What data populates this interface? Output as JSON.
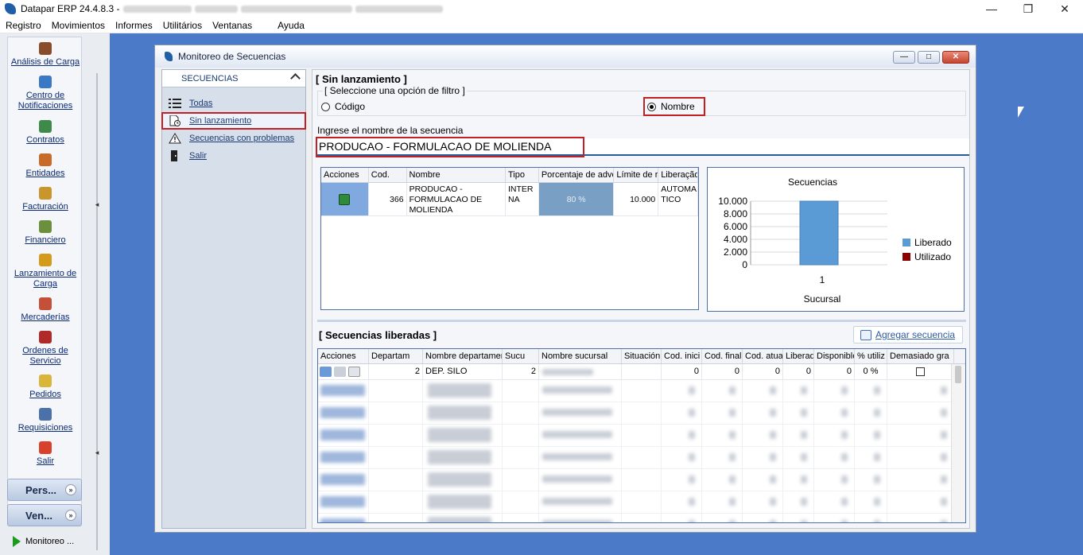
{
  "app": {
    "title": "Datapar ERP 24.4.8.3 -",
    "window_buttons": [
      "—",
      "❐",
      "✕"
    ]
  },
  "menu": [
    "Registro",
    "Movimientos",
    "Informes",
    "Utilitários",
    "Ventanas",
    "Ayuda"
  ],
  "sidebar": {
    "items": [
      {
        "label": "Análisis de Carga",
        "icon": "weight-icon",
        "color": "#8a4b2a"
      },
      {
        "label": "Centro de Notificaciones",
        "icon": "monitor-bell-icon",
        "color": "#3b79c4"
      },
      {
        "label": "Contratos",
        "icon": "contract-icon",
        "color": "#3d8a4a"
      },
      {
        "label": "Entidades",
        "icon": "people-icon",
        "color": "#c86b28"
      },
      {
        "label": "Facturación",
        "icon": "money-bag-icon",
        "color": "#c9962b"
      },
      {
        "label": "Financiero",
        "icon": "coin-bag-icon",
        "color": "#6b8f3a"
      },
      {
        "label": "Lanzamiento de Carga",
        "icon": "truck-icon",
        "color": "#d49a1a"
      },
      {
        "label": "Mercaderías",
        "icon": "box-icon",
        "color": "#c4503a"
      },
      {
        "label": "Ordenes de Servicio",
        "icon": "service-order-icon",
        "color": "#b02a2a"
      },
      {
        "label": "Pedidos",
        "icon": "pedidos-icon",
        "color": "#d9b63a"
      },
      {
        "label": "Requisiciones",
        "icon": "pencil-check-icon",
        "color": "#4a72a8"
      },
      {
        "label": "Salir",
        "icon": "exit-icon",
        "color": "#d8412b"
      }
    ],
    "accordion": [
      {
        "label": "Pers...",
        "chevron": "»"
      },
      {
        "label": "Ven...",
        "chevron": "»"
      }
    ],
    "task": "Monitoreo ..."
  },
  "window": {
    "title": "Monitoreo de Secuencias",
    "buttons": [
      "—",
      "□",
      "✕"
    ]
  },
  "nav": {
    "header": "SECUENCIAS",
    "items": [
      {
        "label": "Todas",
        "icon": "list-icon"
      },
      {
        "label": "Sin lanzamiento",
        "icon": "document-clock-icon",
        "selected": true
      },
      {
        "label": "Secuencias con problemas",
        "icon": "warning-icon"
      },
      {
        "label": "Salir",
        "icon": "door-exit-icon"
      }
    ]
  },
  "main": {
    "section_title": "[ Sin lanzamiento ]",
    "filter_legend": "[ Seleccione una opción de filtro ]",
    "radio_codigo": "Código",
    "radio_nombre": "Nombre",
    "selected_filter": "Nombre",
    "input_label": "Ingrese el nombre de la secuencia",
    "input_value": "PRODUCAO - FORMULACAO DE MOLIENDA"
  },
  "grid1": {
    "headers": [
      "Acciones",
      "Cod.",
      "Nombre",
      "Tipo",
      "Porcentaje de adve",
      "Límite de ra",
      "Liberação"
    ],
    "rows": [
      {
        "cod": "366",
        "nombre": "PRODUCAO - FORMULACAO DE MOLIENDA",
        "tipo": "INTER NA",
        "porcentaje": "80 %",
        "limite": "10.000",
        "liberacao": "AUTOMA TICO"
      }
    ]
  },
  "chart_data": {
    "type": "bar",
    "title": "Secuencias",
    "xlabel": "Sucursal",
    "ylabel": "",
    "categories": [
      "1"
    ],
    "series": [
      {
        "name": "Liberado",
        "values": [
          10000
        ],
        "color": "#5b9bd5"
      },
      {
        "name": "Utilizado",
        "values": [
          0
        ],
        "color": "#8b0000"
      }
    ],
    "ylim": [
      0,
      10000
    ],
    "yticks": [
      "10.000",
      "8.000",
      "6.000",
      "4.000",
      "2.000",
      "0"
    ],
    "grid": true,
    "legend": "right"
  },
  "grid2": {
    "section_title": "[ Secuencias liberadas ]",
    "add_button": "Agregar secuencia",
    "headers": [
      "Acciones",
      "Departam",
      "Nombre departamen",
      "Sucu",
      "Nombre sucursal",
      "Situación",
      "Cod. inici",
      "Cod. final",
      "Cod. atua",
      "Liberad",
      "Disponible",
      "% utiliz",
      "Demasiado gra"
    ],
    "first_row": {
      "departamento": "2",
      "nombre_departamento": "DEP. SILO",
      "sucursal": "2",
      "situacion": "",
      "cod_inicial": "0",
      "cod_final": "0",
      "cod_atual": "0",
      "liberado": "0",
      "disponible": "0",
      "utiliz": "0 %"
    }
  }
}
